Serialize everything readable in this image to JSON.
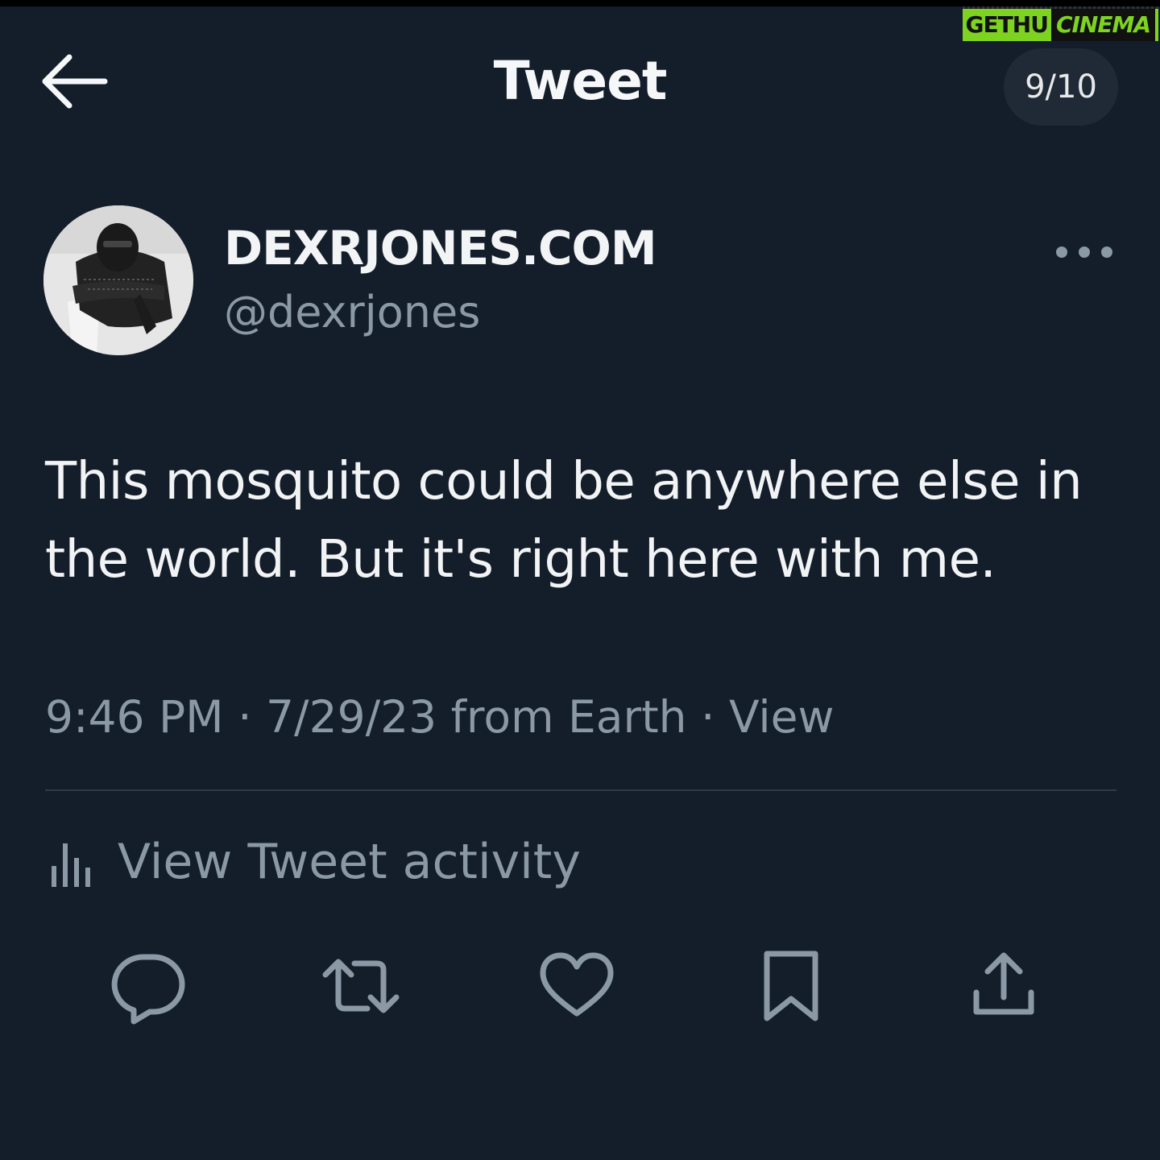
{
  "watermark": {
    "part1": "GETHU",
    "part2": "CINEMA"
  },
  "header": {
    "title": "Tweet",
    "page_indicator": "9/10",
    "back_icon": "arrow-left-icon"
  },
  "author": {
    "display_name": "DEXRJONES.COM",
    "handle": "@dexrjones",
    "more_icon": "more-horizontal-icon"
  },
  "tweet": {
    "text": "This mosquito could be anywhere else in the world. But it's right here with me.",
    "meta": "9:46 PM · 7/29/23 from Earth · View"
  },
  "activity": {
    "label": "View Tweet activity",
    "icon": "bar-chart-icon"
  },
  "actions": [
    {
      "name": "reply",
      "icon": "reply-icon"
    },
    {
      "name": "retweet",
      "icon": "retweet-icon"
    },
    {
      "name": "like",
      "icon": "heart-icon"
    },
    {
      "name": "bookmark",
      "icon": "bookmark-icon"
    },
    {
      "name": "share",
      "icon": "share-icon"
    }
  ],
  "colors": {
    "background": "#141d2a",
    "primary_text": "#e7e9ea",
    "secondary_text": "#8b98a5",
    "icon": "#8b98a5",
    "watermark_green": "#7ed321"
  }
}
